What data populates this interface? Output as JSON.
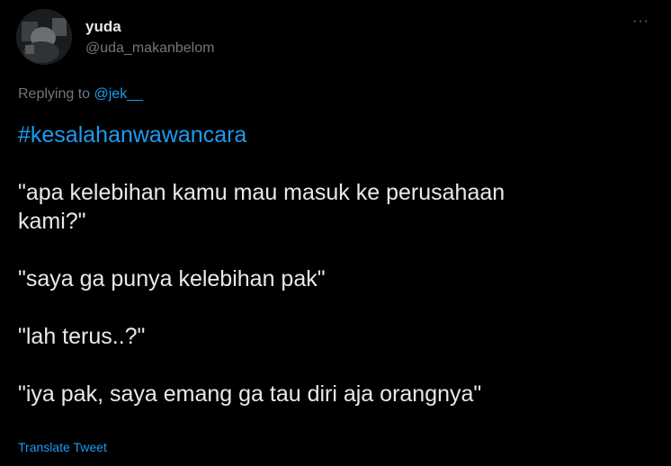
{
  "author": {
    "display_name": "yuda",
    "handle": "@uda_makanbelom",
    "avatar_icon": "profile-photo"
  },
  "more_label": "···",
  "reply": {
    "prefix": "Replying to ",
    "mention": "@jek__"
  },
  "tweet": {
    "hashtag": "#kesalahanwawancara",
    "line1a": "\"apa kelebihan kamu mau masuk ke perusahaan",
    "line1b": "kami?\"",
    "line2": "\"saya ga punya kelebihan pak\"",
    "line3": "\"lah terus..?\"",
    "line4": "\"iya pak, saya emang ga tau diri aja orangnya\""
  },
  "translate_label": "Translate Tweet",
  "colors": {
    "background": "#000000",
    "text": "#e7e9ea",
    "secondary": "#71767b",
    "link": "#1d9bf0"
  }
}
